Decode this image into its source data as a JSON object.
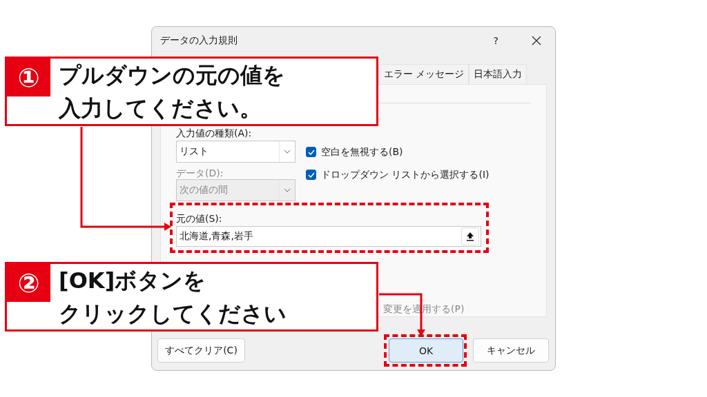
{
  "dialog": {
    "title": "データの入力規則",
    "help_button": "?"
  },
  "tabs": [
    {
      "label": "エラー メッセージ"
    },
    {
      "label": "日本語入力"
    }
  ],
  "allow": {
    "label": "入力値の種類(A):",
    "value": "リスト"
  },
  "options": [
    {
      "label": "空白を無視する(B)",
      "checked": true
    },
    {
      "label": "ドロップダウン リストから選択する(I)",
      "checked": true
    }
  ],
  "data": {
    "label": "データ(D):",
    "value": "次の値の間",
    "disabled": true
  },
  "source": {
    "label": "元の値(S):",
    "value": "北海道,青森,岩手"
  },
  "apply_all": {
    "label": "変更を適用する(P)"
  },
  "buttons": [
    {
      "label": "すべてクリア(C)",
      "selected": false
    },
    {
      "label": "OK",
      "selected": true
    },
    {
      "label": "キャンセル",
      "selected": false
    }
  ],
  "callouts": [
    {
      "number": "①",
      "lines": [
        "プルダウンの元の値を",
        "入力してください。"
      ]
    },
    {
      "number": "②",
      "lines": [
        "[OK]ボタンを",
        "クリックしてください"
      ]
    }
  ]
}
